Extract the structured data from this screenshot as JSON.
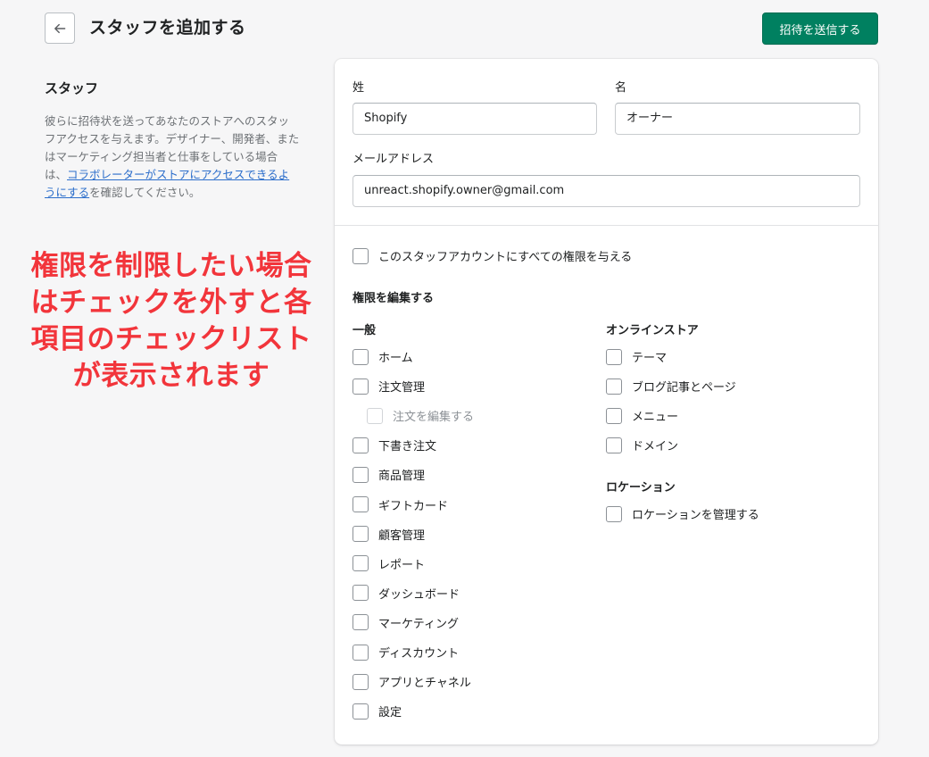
{
  "header": {
    "title": "スタッフを追加する",
    "send_invite_label": "招待を送信する"
  },
  "section": {
    "heading": "スタッフ",
    "description_pre": "彼らに招待状を送ってあなたのストアへのスタッフアクセスを与えます。デザイナー、開発者、またはマーケティング担当者と仕事をしている場合は、",
    "description_link": "コラボレーターがストアにアクセスできるようにする",
    "description_post": "を確認してください。"
  },
  "annotation": {
    "lines": [
      "権限を制限したい場合",
      "はチェックを外すと各",
      "項目のチェックリスト",
      "が表示されます"
    ]
  },
  "form": {
    "last_name_label": "姓",
    "last_name_value": "Shopify",
    "first_name_label": "名",
    "first_name_value": "オーナー",
    "email_label": "メールアドレス",
    "email_value": "unreact.shopify.owner@gmail.com"
  },
  "permissions": {
    "full_access_label": "このスタッフアカウントにすべての権限を与える",
    "edit_heading": "権限を編集する",
    "general": {
      "title": "一般",
      "items": [
        {
          "label": "ホーム",
          "checked": false,
          "disabled": false
        },
        {
          "label": "注文管理",
          "checked": false,
          "disabled": false
        },
        {
          "label": "注文を編集する",
          "checked": false,
          "disabled": true
        },
        {
          "label": "下書き注文",
          "checked": false,
          "disabled": false
        },
        {
          "label": "商品管理",
          "checked": false,
          "disabled": false
        },
        {
          "label": "ギフトカード",
          "checked": false,
          "disabled": false
        },
        {
          "label": "顧客管理",
          "checked": false,
          "disabled": false
        },
        {
          "label": "レポート",
          "checked": false,
          "disabled": false
        },
        {
          "label": "ダッシュボード",
          "checked": false,
          "disabled": false
        },
        {
          "label": "マーケティング",
          "checked": false,
          "disabled": false
        },
        {
          "label": "ディスカウント",
          "checked": false,
          "disabled": false
        },
        {
          "label": "アプリとチャネル",
          "checked": false,
          "disabled": false
        },
        {
          "label": "設定",
          "checked": false,
          "disabled": false
        }
      ]
    },
    "online_store": {
      "title": "オンラインストア",
      "items": [
        {
          "label": "テーマ",
          "checked": false
        },
        {
          "label": "ブログ記事とページ",
          "checked": false
        },
        {
          "label": "メニュー",
          "checked": false
        },
        {
          "label": "ドメイン",
          "checked": false
        }
      ]
    },
    "location": {
      "title": "ロケーション",
      "items": [
        {
          "label": "ロケーションを管理する",
          "checked": false
        }
      ]
    }
  },
  "colors": {
    "primary": "#008060",
    "annotation": "#f2353b",
    "link": "#2c6ecb"
  }
}
